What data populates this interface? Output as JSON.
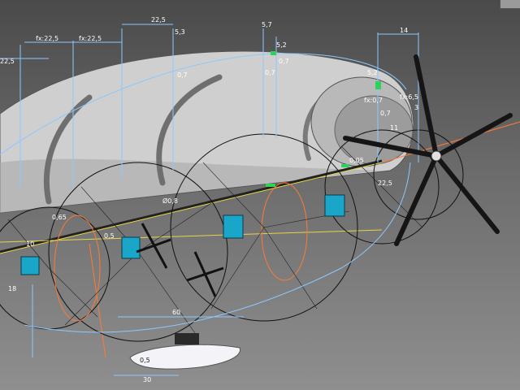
{
  "app": {
    "corner_badge": " "
  },
  "colors": {
    "background_top": "#4a4a4a",
    "background_bottom": "#8f8f8f",
    "envelope": "#cfcfcf",
    "dimension_line": "#8cc8ff",
    "construction_line": "#000000",
    "axis_line": "#ff7a33",
    "guide_line": "#e6d34a",
    "selection_marker": "#2fd15a",
    "payload_box": "#1aa6c8",
    "gondola": "#f4f4f8"
  },
  "dimensions": {
    "top_22_5_left": "22,5",
    "fx_22_5_a": "fx:22,5",
    "fx_22_5_b": "fx:22,5",
    "top_22_5": "22,5",
    "dim_5_3": "5,3",
    "dim_5_7": "5,7",
    "dim_5_2_top": "5,2",
    "dim_0_7_a": "0,7",
    "dim_0_7_b": "0,7",
    "dim_0_7_c": "0,7",
    "dim_14": "14",
    "dim_5_2_right": "5,2",
    "fx_0_7": "fx:0,7",
    "fx_6_5": "fx:6,5",
    "dim_0_7_d": "0,7",
    "dim_11": "11",
    "dim_3": "3",
    "dim_0_05": "0,05",
    "dim_22_5_low": "22,5",
    "dia_0_8": "Ø0,8",
    "dim_0_65": "0,65",
    "dim_0_5": "0,5",
    "dim_10": "10",
    "dim_18": "18",
    "dim_60": "60",
    "dim_0_5_b": "0,5",
    "dim_30": "30"
  }
}
